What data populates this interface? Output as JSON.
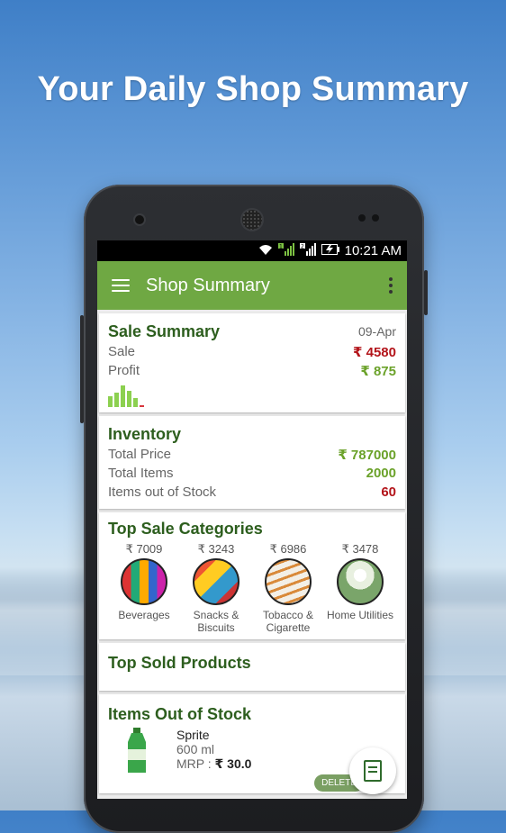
{
  "promo": {
    "headline": "Your Daily Shop Summary"
  },
  "status_bar": {
    "time": "10:21 AM",
    "sim1": "1",
    "sim2": "2"
  },
  "app_bar": {
    "title": "Shop Summary"
  },
  "sale_summary": {
    "title": "Sale Summary",
    "date": "09-Apr",
    "sale_label": "Sale",
    "sale_value": "₹ 4580",
    "profit_label": "Profit",
    "profit_value": "₹ 875"
  },
  "inventory": {
    "title": "Inventory",
    "total_price_label": "Total Price",
    "total_price_value": "₹ 787000",
    "total_items_label": "Total Items",
    "total_items_value": "2000",
    "out_of_stock_label": "Items out of Stock",
    "out_of_stock_value": "60"
  },
  "top_categories": {
    "title": "Top Sale Categories",
    "items": [
      {
        "amount": "₹ 7009",
        "label": "Beverages"
      },
      {
        "amount": "₹ 3243",
        "label": "Snacks & Biscuits"
      },
      {
        "amount": "₹ 6986",
        "label": "Tobacco & Cigarette"
      },
      {
        "amount": "₹ 3478",
        "label": "Home Utilities"
      }
    ]
  },
  "top_sold": {
    "title": "Top Sold Products"
  },
  "out_of_stock": {
    "title": "Items Out of Stock",
    "product_name": "Sprite",
    "product_size": "600 ml",
    "mrp_label": "MRP :",
    "mrp_value": "₹ 30.0",
    "delete_label": "DELETE"
  },
  "colors": {
    "appbar": "#6fa843",
    "heading": "#2d5e1e",
    "positive": "#6ba22a",
    "negative": "#b3141a"
  }
}
